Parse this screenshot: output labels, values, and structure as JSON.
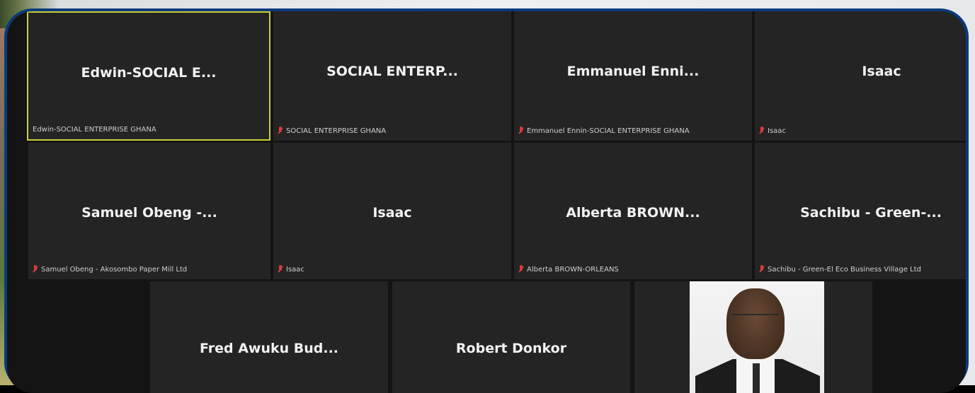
{
  "participants": {
    "row1": [
      {
        "display": "Edwin-SOCIAL E...",
        "label": "Edwin-SOCIAL ENTERPRISE GHANA",
        "muted": false,
        "active": true
      },
      {
        "display": "SOCIAL ENTERP...",
        "label": "SOCIAL ENTERPRISE GHANA",
        "muted": true
      },
      {
        "display": "Emmanuel Enni...",
        "label": "Emmanuel Ennin-SOCIAL ENTERPRISE GHANA",
        "muted": true
      },
      {
        "display": "Isaac",
        "label": "Isaac",
        "muted": true
      }
    ],
    "row2": [
      {
        "display": "Samuel Obeng -...",
        "label": "Samuel Obeng - Akosombo Paper Mill Ltd",
        "muted": true
      },
      {
        "display": "Isaac",
        "label": "Isaac",
        "muted": true
      },
      {
        "display": "Alberta BROWN...",
        "label": "Alberta BROWN-ORLEANS",
        "muted": true
      },
      {
        "display": "Sachibu - Green-...",
        "label": "Sachibu - Green-El Eco Business Village Ltd",
        "muted": true
      }
    ],
    "row3": [
      {
        "display": "Fred Awuku Bud..."
      },
      {
        "display": "Robert Donkor"
      }
    ]
  },
  "icons": {
    "muted": "mic-muted-icon"
  },
  "colors": {
    "active_speaker_border": "#c8d13a",
    "tile_background": "#242424",
    "frame_blue": "#0c3a7a",
    "muted_icon": "#d93a3a"
  }
}
